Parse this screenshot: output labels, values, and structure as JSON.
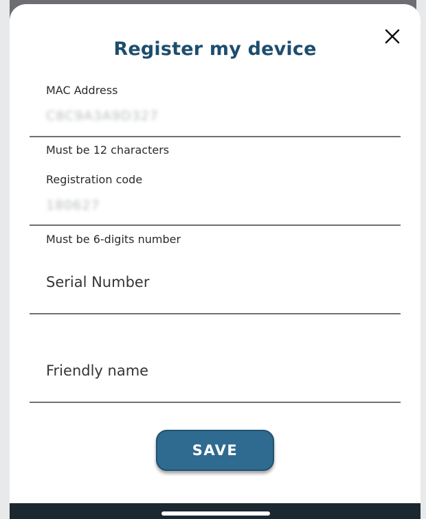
{
  "dialog": {
    "title": "Register my device",
    "close_icon": "close-icon"
  },
  "form": {
    "mac_address": {
      "label": "MAC Address",
      "value": "C8C9A3A9D327",
      "helper": "Must be 12 characters"
    },
    "registration_code": {
      "label": "Registration code",
      "value": "180627",
      "helper": "Must be 6-digits number"
    },
    "serial_number": {
      "placeholder": "Serial Number"
    },
    "friendly_name": {
      "placeholder": "Friendly name"
    }
  },
  "actions": {
    "save_label": "SAVE"
  },
  "colors": {
    "title": "#1e4d6e",
    "button": "#2f6a90",
    "bottom_bar": "#1b2830"
  }
}
